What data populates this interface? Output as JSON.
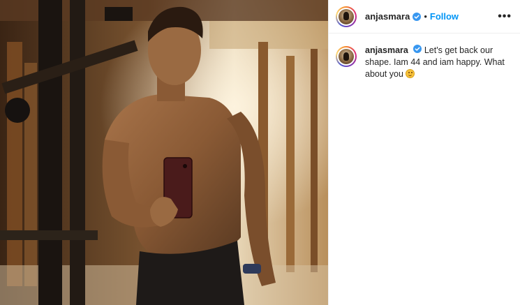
{
  "post": {
    "username": "anjasmara",
    "dot": "•",
    "follow_label": "Follow",
    "more_icon": "•••",
    "verified": true,
    "caption_user": "anjasmara",
    "caption_text": "Let's get back our shape. Iam 44 and iam happy. What about you",
    "caption_emoji": "smiling-face-emoji"
  },
  "colors": {
    "follow": "#0095f6",
    "verified_badge": "#3897f0",
    "text": "#262626"
  }
}
